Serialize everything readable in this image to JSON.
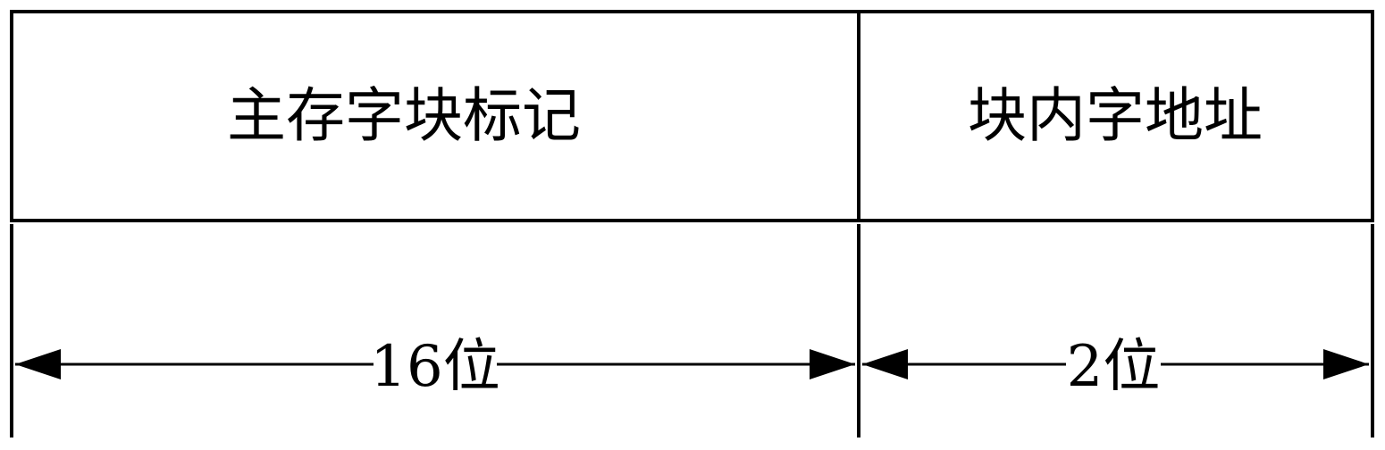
{
  "fields": [
    {
      "label": "主存字块标记",
      "width_label": "16位"
    },
    {
      "label": "块内字地址",
      "width_label": "2位"
    }
  ]
}
